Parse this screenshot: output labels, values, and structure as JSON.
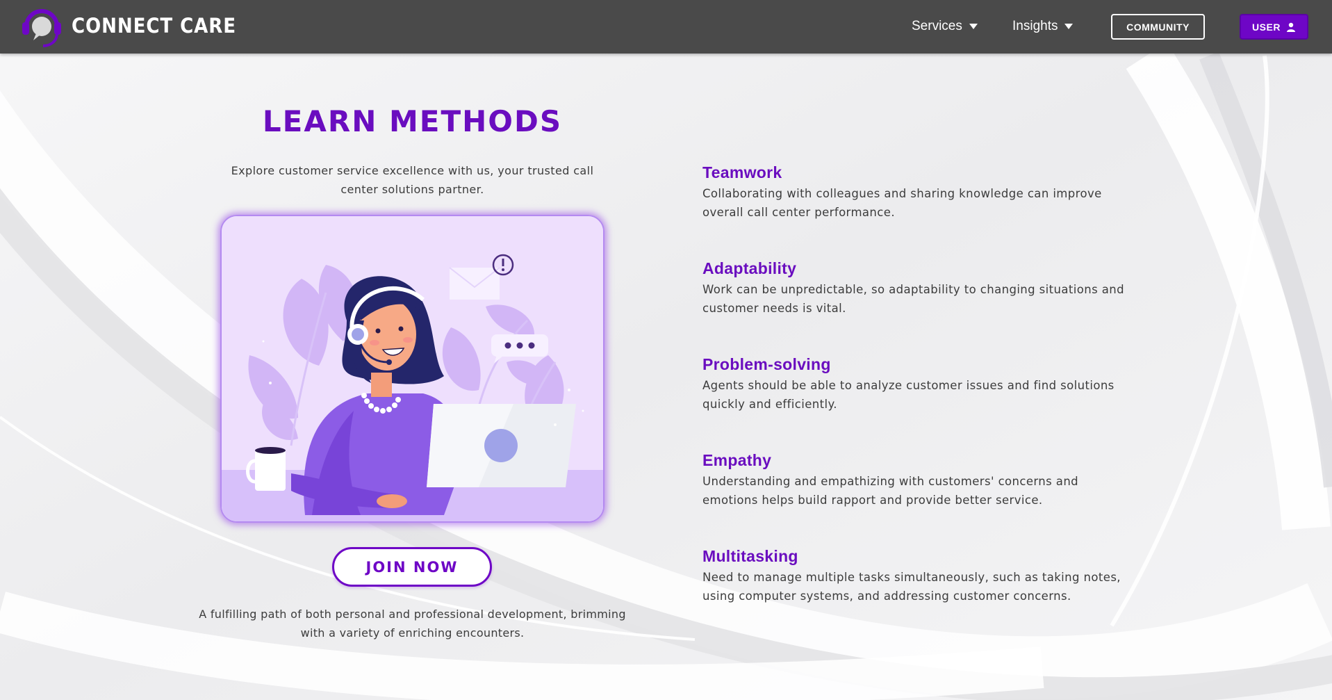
{
  "header": {
    "brand": "CONNECT CARE",
    "nav": [
      {
        "label": "Services"
      },
      {
        "label": "Insights"
      }
    ],
    "community_label": "COMMUNITY",
    "user_label": "USER"
  },
  "hero": {
    "title": "LEARN METHODS",
    "subtitle": "Explore customer service excellence with us, your trusted call center solutions partner.",
    "join_label": "JOIN NOW",
    "footnote": "A fulfilling path of both personal and professional development, brimming with a variety of enriching encounters."
  },
  "features": [
    {
      "title": "Teamwork",
      "text": "Collaborating with colleagues and sharing knowledge can improve overall call center performance."
    },
    {
      "title": "Adaptability",
      "text": "Work can be unpredictable, so adaptability to changing situations and customer needs is vital."
    },
    {
      "title": "Problem-solving",
      "text": "Agents should be able to analyze customer issues and find solutions quickly and efficiently."
    },
    {
      "title": "Empathy",
      "text": "Understanding and empathizing with customers' concerns and emotions helps build rapport and provide better service."
    },
    {
      "title": "Multitasking",
      "text": "Need to manage multiple tasks simultaneously, such as taking notes, using computer systems, and addressing customer concerns."
    }
  ],
  "colors": {
    "accent": "#6e06c6",
    "nav_background": "#4a4a4a",
    "illustration_background": "#eedffd"
  },
  "icons": {
    "logo": "headset-chat-logo",
    "caret": "caret-down-icon",
    "user": "user-icon"
  }
}
